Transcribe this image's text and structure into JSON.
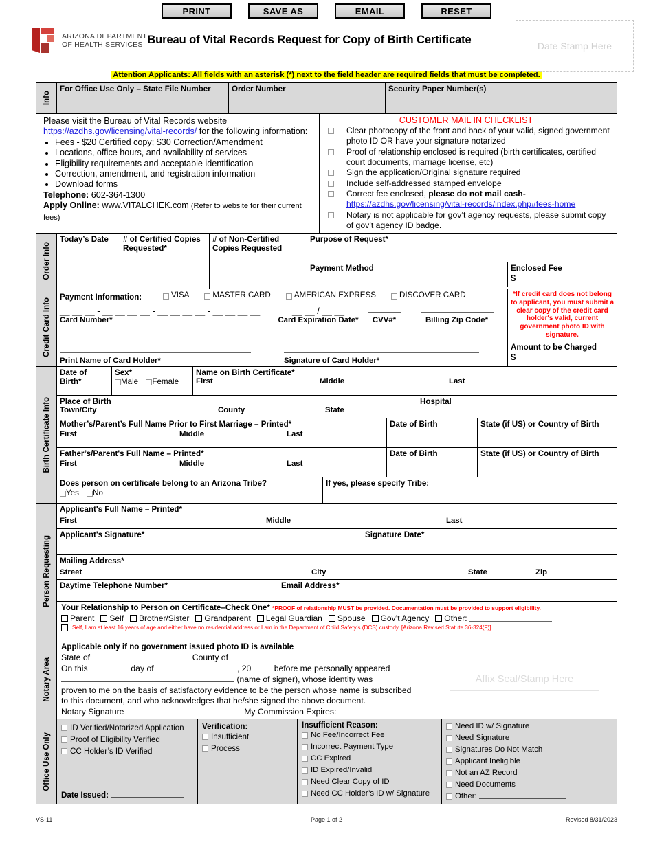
{
  "toolbar": {
    "buttons": [
      {
        "label": "PRINT",
        "name": "print-button"
      },
      {
        "label": "SAVE AS",
        "name": "save-as-button"
      },
      {
        "label": "EMAIL",
        "name": "email-button"
      },
      {
        "label": "RESET",
        "name": "reset-button"
      }
    ]
  },
  "header": {
    "agency_line1": "ARIZONA DEPARTMENT",
    "agency_line2": "OF HEALTH SERVICES",
    "title": "Bureau of Vital Records Request for Copy of Birth Certificate",
    "date_stamp_placeholder": "Date Stamp Here"
  },
  "attention": "Attention Applicants: All fields with an asterisk (*) next to the field header are required fields that must be completed.",
  "info_section": {
    "band_label": "Info",
    "state_file_number": "For Office Use Only – State File Number",
    "order_number": "Order Number",
    "security_paper": "Security Paper Number(s)"
  },
  "website_section": {
    "intro_1": "Please visit the Bureau of Vital Records website",
    "url": "https://azdhs.gov/licensing/vital-records/",
    "intro_2": " for the following information:",
    "bullets": [
      "Fees - $20 Certified copy; $30 Correction/Amendment",
      "Locations, office hours, and availability of services",
      "Eligibility requirements and acceptable identification",
      "Correction, amendment, and registration information",
      "Download forms"
    ],
    "telephone_label": "Telephone:",
    "telephone_value": " 602-364-1300",
    "apply_label": "Apply Online:",
    "apply_value": " www.VITALCHEK.com",
    "apply_note": " (Refer to website for their current fees)"
  },
  "checklist": {
    "title": "CUSTOMER MAIL IN CHECKLIST",
    "items": [
      {
        "text": "Clear photocopy of the front and back of your valid, signed government photo ID OR have your signature notarized"
      },
      {
        "text": "Proof of relationship enclosed is required (birth certificates, certified court documents, marriage license, etc)"
      },
      {
        "text": "Sign the application/Original signature required"
      },
      {
        "text": "Include self-addressed stamped envelope"
      },
      {
        "text": "Correct fee enclosed, ",
        "bold": "please do not mail cash",
        "suffix": "-",
        "link": "https://azdhs.gov/licensing/vital-records/index.php#fees-home"
      },
      {
        "text": "Notary is not applicable for gov’t agency requests, please submit copy of gov’t agency ID badge."
      }
    ]
  },
  "order_info": {
    "band_label": "Order Info",
    "todays_date": "Today’s Date",
    "certified_copies": "# of Certified Copies Requested*",
    "non_certified_copies": "# of Non-Certified Copies Requested",
    "purpose": "Purpose of Request*",
    "payment_method": "Payment Method",
    "enclosed_fee": "Enclosed Fee",
    "dollar": "$"
  },
  "credit_card": {
    "band_label": "Credit Card Info",
    "payment_information": "Payment Information:",
    "cards": [
      "VISA",
      "MASTER CARD",
      "AMERICAN EXPRESS",
      "DISCOVER CARD"
    ],
    "card_number_mask": "__ __ __ - __ __ __ __ - __ __ __ __ - __ __ __ __",
    "card_number_label": "Card Number*",
    "expiration_mask": "__ __ / __ __",
    "expiration_label": "Card Expiration Date*",
    "cvv_label": "CVV#*",
    "billing_zip_label": "Billing Zip Code*",
    "print_name_label": "Print Name of Card Holder*",
    "signature_label": "Signature of Card Holder*",
    "red_note": "*If credit card does not belong to applicant, you must submit a clear copy of the credit card holder's valid, current government photo ID with signature.",
    "amount_charged": "Amount to be Charged",
    "dollar": "$"
  },
  "birth_certificate": {
    "band_label": "Birth Certificate Info",
    "date_of_birth": "Date of Birth*",
    "sex": "Sex*",
    "sex_options": [
      "Male",
      "Female"
    ],
    "name_on_certificate": "Name on Birth Certificate*",
    "first": "First",
    "middle": "Middle",
    "last": "Last",
    "place_of_birth": "Place of Birth",
    "town_city": "Town/City",
    "county": "County",
    "state": "State",
    "hospital": "Hospital",
    "mother_label": "Mother’s/Parent’s Full Name Prior to First Marriage – Printed*",
    "father_label": "Father’s/Parent's Full Name – Printed*",
    "parent_dob": "Date of Birth",
    "parent_state": "State (if US) or Country of Birth",
    "tribe_question": "Does person on certificate belong to an Arizona Tribe?",
    "tribe_options": [
      "Yes",
      "No"
    ],
    "tribe_specify": "If yes, please specify Tribe:"
  },
  "person_requesting": {
    "band_label": "Person Requesting",
    "applicant_name": "Applicant's Full Name – Printed*",
    "first": "First",
    "middle": "Middle",
    "last": "Last",
    "applicant_signature": "Applicant's Signature*",
    "signature_date": "Signature Date*",
    "mailing_address": "Mailing Address*",
    "street": "Street",
    "city": "City",
    "state": "State",
    "zip": "Zip",
    "daytime_phone": "Daytime Telephone Number*",
    "email": "Email Address*",
    "relationship_label": "Your Relationship to Person on Certificate–Check One*",
    "relationship_proof": "*PROOF of relationship MUST be provided. Documentation must be provided to support eligibility.",
    "relationship_options": [
      "Parent",
      "Self",
      "Brother/Sister",
      "Grandparent",
      "Legal Guardian",
      "Spouse",
      "Gov’t Agency"
    ],
    "relationship_other": "Other:",
    "self_statute": "Self, I am at least 16 years of age and either have no residential address or I am in the Department of Child Safety’s (DCS) custody. [Arizona Revised Statute 36-324(F)]"
  },
  "notary": {
    "band_label": "Notary Area",
    "heading": "Applicable only if no government issued photo ID is available",
    "state_of": "State of",
    "county_of": "County of",
    "on_this": "On this",
    "day_of": "day of",
    "year_prefix": ", 20",
    "appeared": "before me personally appeared",
    "name_of_signer": "(name of signer), whose identity was",
    "body_1": "proven to me on the basis of satisfactory evidence to be the person whose name is subscribed",
    "body_2": "to this document, and who acknowledges that he/she signed the above document.",
    "signature_label": "Notary Signature",
    "expires_label": "My Commission Expires:",
    "seal_placeholder": "Affix Seal/Stamp Here"
  },
  "office_use": {
    "band_label": "Office Use Only",
    "col1": [
      "ID Verified/Notarized Application",
      "Proof of Eligibility Verified",
      "CC Holder’s ID Verified"
    ],
    "date_issued": "Date Issued:",
    "verification_label": "Verification:",
    "verification_options": [
      "Insufficient",
      "Process"
    ],
    "insufficient_label": "Insufficient Reason:",
    "insufficient_col1": [
      "No Fee/Incorrect Fee",
      "Incorrect Payment Type",
      "CC Expired",
      "ID Expired/Invalid",
      "Need Clear Copy of ID",
      "Need CC Holder’s ID w/ Signature"
    ],
    "insufficient_col2": [
      "Need ID w/ Signature",
      "Need Signature",
      "Signatures Do Not Match",
      "Applicant Ineligible",
      "Not an AZ Record",
      "Need Documents",
      "Other:"
    ]
  },
  "footer": {
    "form_number": "VS-11",
    "page": "Page 1 of 2",
    "revised": "Revised 8/31/2023"
  },
  "colors": {
    "highlight": "#ffff00",
    "red": "#ff0000",
    "link": "#1a1ae0",
    "shade": "#d9d9d9",
    "logo_red": "#c8202a"
  }
}
